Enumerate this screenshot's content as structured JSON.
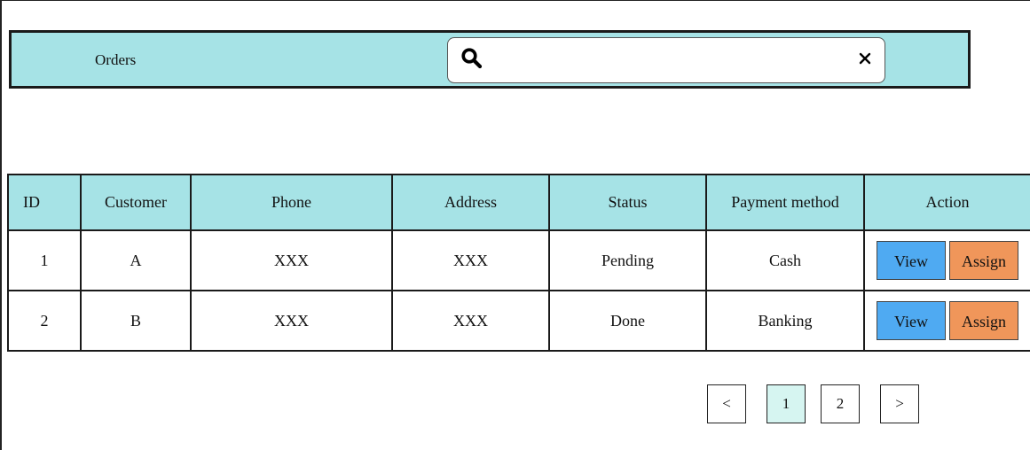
{
  "header": {
    "title": "Orders",
    "search": {
      "value": "",
      "placeholder": "",
      "icon": "search-icon",
      "clear_icon": "close-icon"
    }
  },
  "table": {
    "columns": [
      "ID",
      "Customer",
      "Phone",
      "Address",
      "Status",
      "Payment method",
      "Action"
    ],
    "rows": [
      {
        "id": "1",
        "customer": "A",
        "phone": "XXX",
        "address": "XXX",
        "status": "Pending",
        "payment": "Cash"
      },
      {
        "id": "2",
        "customer": "B",
        "phone": "XXX",
        "address": "XXX",
        "status": "Done",
        "payment": "Banking"
      }
    ],
    "actions": {
      "view": "View",
      "assign": "Assign"
    }
  },
  "pagination": {
    "prev": "<",
    "pages": [
      "1",
      "2"
    ],
    "current": "1",
    "next": ">"
  },
  "colors": {
    "header_bg": "#a6e3e6",
    "view_button": "#4faaf2",
    "assign_button": "#f0965a",
    "active_page": "#d6f5f1"
  }
}
